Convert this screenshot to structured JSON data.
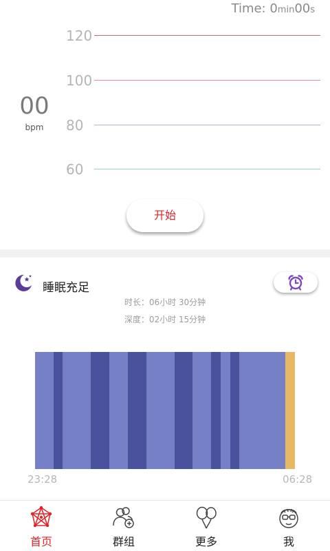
{
  "heart_rate": {
    "timer": {
      "prefix": "Time: ",
      "minutes": "0",
      "min_unit": "min",
      "seconds": "00",
      "sec_unit": "s"
    },
    "value": "00",
    "unit": "bpm",
    "levels": [
      {
        "label": "120",
        "color": "#c96a73"
      },
      {
        "label": "100",
        "color": "#f08aa3"
      },
      {
        "label": "80",
        "color": "#b7aee0"
      },
      {
        "label": "60",
        "color": "#9fd3d3"
      }
    ],
    "start_label": "开始"
  },
  "sleep": {
    "title": "睡眠充足",
    "duration_label": "时长：",
    "duration_value": "06小时 30分钟",
    "deep_label": "深度：",
    "deep_value": "02小时 15分钟",
    "start_time": "23:28",
    "end_time": "06:28",
    "colors": {
      "light": "#7580c6",
      "deep": "#4a519d",
      "awake": "#e8b862"
    },
    "chart_data": {
      "type": "bar",
      "title": "",
      "xlabel": "",
      "ylabel": "",
      "x_range": [
        "23:28",
        "06:28"
      ],
      "segments": [
        {
          "stage": "light",
          "start": 0.0,
          "end": 0.071
        },
        {
          "stage": "deep",
          "start": 0.071,
          "end": 0.106
        },
        {
          "stage": "light",
          "start": 0.106,
          "end": 0.214
        },
        {
          "stage": "deep",
          "start": 0.214,
          "end": 0.286
        },
        {
          "stage": "light",
          "start": 0.286,
          "end": 0.357
        },
        {
          "stage": "deep",
          "start": 0.357,
          "end": 0.428
        },
        {
          "stage": "light",
          "start": 0.428,
          "end": 0.536
        },
        {
          "stage": "deep",
          "start": 0.536,
          "end": 0.607
        },
        {
          "stage": "light",
          "start": 0.607,
          "end": 0.678
        },
        {
          "stage": "deep",
          "start": 0.678,
          "end": 0.714
        },
        {
          "stage": "light",
          "start": 0.714,
          "end": 0.75
        },
        {
          "stage": "deep",
          "start": 0.75,
          "end": 0.786
        },
        {
          "stage": "light",
          "start": 0.786,
          "end": 0.964
        },
        {
          "stage": "awake",
          "start": 0.964,
          "end": 1.0
        }
      ]
    }
  },
  "nav": {
    "items": [
      {
        "label": "首页",
        "icon": "network-icon",
        "active": true
      },
      {
        "label": "群组",
        "icon": "group-add-icon",
        "active": false
      },
      {
        "label": "更多",
        "icon": "balloons-icon",
        "active": false
      },
      {
        "label": "我",
        "icon": "avatar-glasses-icon",
        "active": false
      }
    ],
    "active_color": "#e0242a"
  }
}
